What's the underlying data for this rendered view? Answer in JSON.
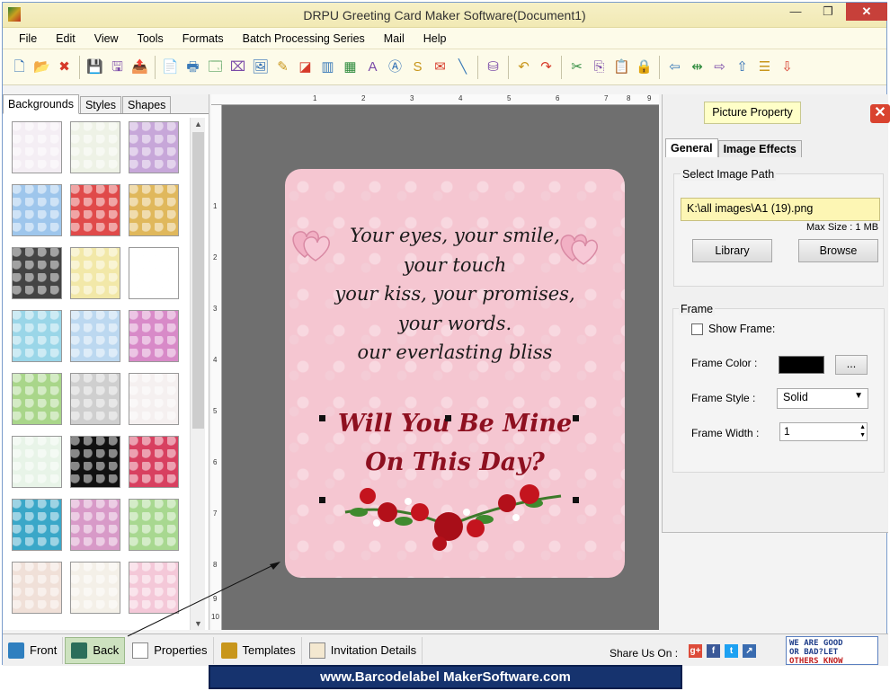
{
  "window": {
    "title": "DRPU Greeting Card Maker Software(Document1)",
    "minimize": "—",
    "restore": "❐",
    "close": "✕"
  },
  "menu": [
    "File",
    "Edit",
    "View",
    "Tools",
    "Formats",
    "Batch Processing Series",
    "Mail",
    "Help"
  ],
  "toolbar_icons": [
    "new-icon",
    "open-icon",
    "close-doc-icon",
    "sep",
    "save-icon",
    "save-as-icon",
    "export-icon",
    "sep",
    "properties-icon",
    "print-icon",
    "print-preview-icon",
    "crop-icon",
    "image-icon",
    "pen-icon",
    "shape-icon",
    "barcode-icon",
    "barcode2-icon",
    "text-icon",
    "wordart-icon",
    "signature-icon",
    "envelope-icon",
    "line-icon",
    "sep",
    "database-icon",
    "sep",
    "undo-icon",
    "redo-icon",
    "sep",
    "cut-icon",
    "copy-icon",
    "paste-icon",
    "lock-icon",
    "sep",
    "left-icon",
    "flip-icon",
    "right-icon",
    "up-icon",
    "align-icon",
    "down-icon"
  ],
  "left_tabs": [
    "Backgrounds",
    "Styles",
    "Shapes"
  ],
  "ruler_top": [
    "1",
    "2",
    "3",
    "4",
    "5",
    "6",
    "7",
    "8",
    "9"
  ],
  "ruler_left": [
    "1",
    "2",
    "3",
    "4",
    "5",
    "6",
    "7",
    "8",
    "9",
    "10"
  ],
  "card": {
    "poem": [
      "Your eyes, your smile,",
      "your touch",
      "your kiss, your promises,",
      "your words.",
      "our everlasting bliss"
    ],
    "headline": [
      "Will You Be Mine",
      "On This Day?"
    ]
  },
  "right_panel": {
    "title": "Picture Property",
    "close": "✕",
    "tabs": [
      "General",
      "Image Effects"
    ],
    "image_path_label": "Select Image Path",
    "image_path": "K:\\all images\\A1 (19).png",
    "max_size": "Max Size : 1 MB",
    "library_button": "Library",
    "browse_button": "Browse",
    "frame_label": "Frame",
    "show_frame": "Show Frame:",
    "show_frame_checked": false,
    "frame_color_label": "Frame Color :",
    "frame_color": "#000000",
    "frame_color_button": "...",
    "frame_style_label": "Frame Style :",
    "frame_style": "Solid",
    "frame_width_label": "Frame Width :",
    "frame_width": "1"
  },
  "bottom": {
    "front": "Front",
    "back": "Back",
    "properties": "Properties",
    "templates": "Templates",
    "invitation": "Invitation Details",
    "share_label": "Share Us On :",
    "feedback": [
      "WE ARE GOOD",
      "OR BAD?LET",
      "OTHERS KNOW"
    ]
  },
  "footer": "www.Barcodelabel MakerSoftware.com"
}
